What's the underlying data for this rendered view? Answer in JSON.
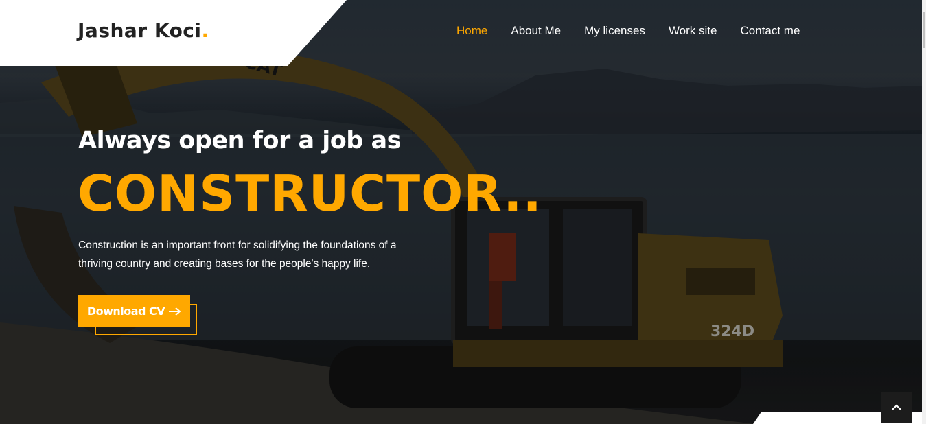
{
  "brand": {
    "name": "Jashar Koci",
    "dot": "."
  },
  "nav": {
    "items": [
      {
        "label": "Home",
        "active": true
      },
      {
        "label": "About Me",
        "active": false
      },
      {
        "label": "My licenses",
        "active": false
      },
      {
        "label": "Work site",
        "active": false
      },
      {
        "label": "Contact me",
        "active": false
      }
    ]
  },
  "hero": {
    "headline": "Always open for a job as",
    "role": "CONSTRUCTOR..",
    "description": "Construction is an important front for solidifying the foundations of a thriving country and creating bases for the people's happy life.",
    "cv_button_label": "Download CV",
    "cv_button_icon": "arrow-right-icon",
    "image_text_brand": "CAT",
    "image_text_model": "324D"
  },
  "scroll_top": {
    "icon": "chevron-up-icon"
  },
  "colors": {
    "accent": "#ffa800",
    "text": "#ffffff",
    "dark": "#222222"
  }
}
